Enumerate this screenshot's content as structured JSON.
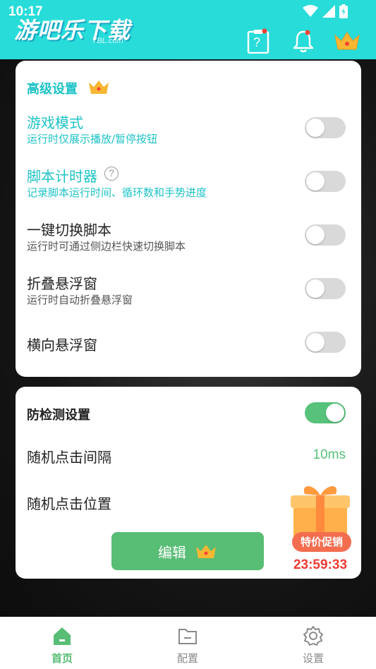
{
  "status_bar": {
    "time": "10:17"
  },
  "header": {
    "logo_text": "游吧乐下载",
    "logo_sub": "YBL.com",
    "clipboard_text": "?",
    "bg_color": "#27dcd9"
  },
  "advanced": {
    "title": "高级设置",
    "items": [
      {
        "title": "游戏模式",
        "subtitle": "运行时仅展示播放/暂停按钮",
        "enabled": false
      },
      {
        "title": "脚本计时器",
        "subtitle": "记录脚本运行时间、循环数和手势进度",
        "enabled": false
      },
      {
        "title": "一键切换脚本",
        "subtitle": "运行时可通过侧边栏快速切换脚本",
        "enabled": false
      },
      {
        "title": "折叠悬浮窗",
        "subtitle": "运行时自动折叠悬浮窗",
        "enabled": false
      },
      {
        "title": "横向悬浮窗",
        "subtitle": "",
        "enabled": false
      }
    ],
    "help_glyph": "?"
  },
  "anti_detect": {
    "title": "防检测设置",
    "enabled": true,
    "interval_label": "随机点击间隔",
    "interval_value": "10ms",
    "position_label": "随机点击位置",
    "edit_label": "编辑"
  },
  "promo": {
    "label": "特价促销",
    "timer": "23:59:33"
  },
  "bottom_nav": {
    "items": [
      {
        "label": "首页",
        "active": true
      },
      {
        "label": "配置",
        "active": false
      },
      {
        "label": "设置",
        "active": false
      }
    ]
  },
  "colors": {
    "teal": "#1fc3c7",
    "green": "#57c27a",
    "red": "#ee3b33",
    "crown": "#f7b733"
  }
}
